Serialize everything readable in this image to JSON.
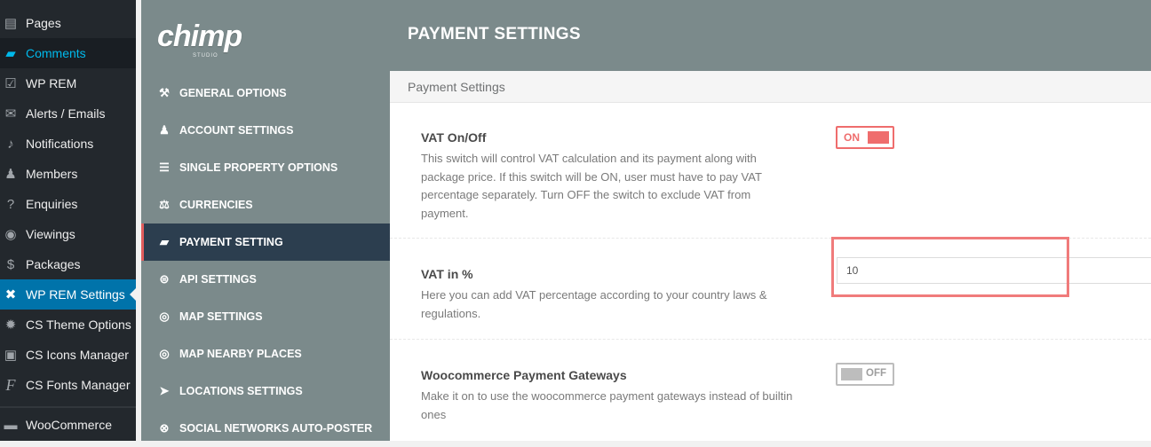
{
  "wp_menu": {
    "items": [
      {
        "label": "Pages",
        "icon": "pages-icon",
        "glyph": "▤"
      },
      {
        "label": "Comments",
        "icon": "comments-icon",
        "glyph": "▰"
      },
      {
        "label": "WP REM",
        "icon": "checklist-icon",
        "glyph": "☑"
      },
      {
        "label": "Alerts / Emails",
        "icon": "mail-icon",
        "glyph": "✉"
      },
      {
        "label": "Notifications",
        "icon": "bell-icon",
        "glyph": "♪"
      },
      {
        "label": "Members",
        "icon": "user-icon",
        "glyph": "♟"
      },
      {
        "label": "Enquiries",
        "icon": "question-icon",
        "glyph": "?"
      },
      {
        "label": "Viewings",
        "icon": "eye-icon",
        "glyph": "◉"
      },
      {
        "label": "Packages",
        "icon": "coin-icon",
        "glyph": "$"
      },
      {
        "label": "WP REM Settings",
        "icon": "tools-icon",
        "glyph": "✖"
      },
      {
        "label": "CS Theme Options",
        "icon": "gear-icon",
        "glyph": "✹"
      },
      {
        "label": "CS Icons Manager",
        "icon": "icon-manager-icon",
        "glyph": "▣"
      },
      {
        "label": "CS Fonts Manager",
        "icon": "font-icon",
        "glyph": "F"
      },
      {
        "label": "WooCommerce",
        "icon": "woocommerce-icon",
        "glyph": "▬"
      }
    ]
  },
  "plugin": {
    "logo_text": "chimp",
    "logo_sub": "STUDIO",
    "header_title": "PAYMENT SETTINGS",
    "nav": [
      {
        "label": "GENERAL OPTIONS",
        "icon": "wrench-icon",
        "glyph": "🔧"
      },
      {
        "label": "ACCOUNT SETTINGS",
        "icon": "user-icon",
        "glyph": "👤"
      },
      {
        "label": "SINGLE PROPERTY OPTIONS",
        "icon": "list-icon",
        "glyph": "☰"
      },
      {
        "label": "CURRENCIES",
        "icon": "money-icon",
        "glyph": "👜"
      },
      {
        "label": "PAYMENT SETTING",
        "icon": "wallet-icon",
        "glyph": "▰"
      },
      {
        "label": "API SETTINGS",
        "icon": "api-icon",
        "glyph": "⊜"
      },
      {
        "label": "MAP SETTINGS",
        "icon": "map-pin-icon",
        "glyph": "◎"
      },
      {
        "label": "MAP NEARBY PLACES",
        "icon": "map-pin-icon",
        "glyph": "◎"
      },
      {
        "label": "LOCATIONS SETTINGS",
        "icon": "location-arrow-icon",
        "glyph": "➤"
      },
      {
        "label": "SOCIAL NETWORKS AUTO-POSTER",
        "icon": "share-icon",
        "glyph": "⊗"
      }
    ]
  },
  "content": {
    "section_title": "Payment Settings",
    "vat_toggle": {
      "title": "VAT On/Off",
      "description": "This switch will control VAT calculation and its payment along with package price. If this switch will be ON, user must have to pay VAT percentage separately. Turn OFF the switch to exclude VAT from payment.",
      "state": "ON"
    },
    "vat_percent": {
      "title": "VAT in %",
      "description": "Here you can add VAT percentage according to your country laws & regulations.",
      "value": "10"
    },
    "woo_gateways": {
      "title": "Woocommerce Payment Gateways",
      "description": "Make it on to use the woocommerce payment gateways instead of builtin ones",
      "state": "OFF"
    }
  },
  "colors": {
    "wp_sidebar": "#23282d",
    "wp_active": "#0073aa",
    "plugin_panel": "#7b8a8b",
    "nav_active": "#2c3e4f",
    "accent_red": "#ef6d6d"
  }
}
